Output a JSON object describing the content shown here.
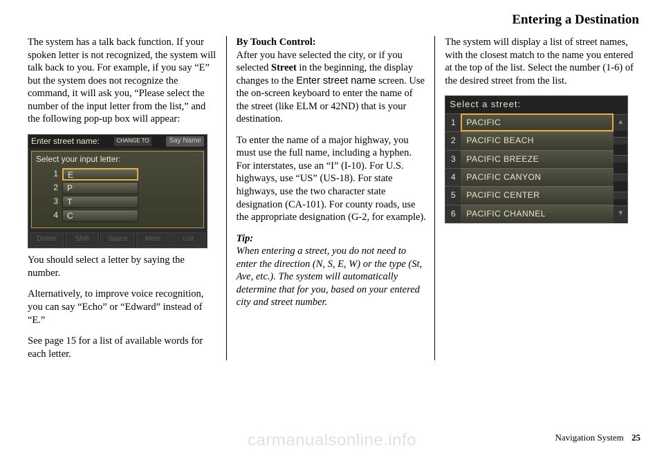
{
  "header": "Entering a Destination",
  "col1": {
    "p1": "The system has a talk back function. If your spoken letter is not recognized, the system will talk back to you. For example, if you say “E” but the system does not recognize the command, it will ask you, “Please select the number of the input letter from the list,” and the following pop-up box will appear:",
    "nav_title": "Enter street name:",
    "change": "CHANGE TO",
    "sayname": "Say Name",
    "popup_title": "Select your input letter:",
    "letters": [
      {
        "n": "1",
        "v": "E"
      },
      {
        "n": "2",
        "v": "P"
      },
      {
        "n": "3",
        "v": "T"
      },
      {
        "n": "4",
        "v": "C"
      }
    ],
    "footer_btns": [
      "Delete",
      "Shift",
      "Space",
      "More",
      "List"
    ],
    "p2": "You should select a letter by saying the number.",
    "p3": "Alternatively, to improve voice recognition, you can say “Echo” or “Edward” instead of “E.”",
    "p4": "See page 15 for a list of available words for each letter."
  },
  "col2": {
    "h": "By Touch Control:",
    "p1a": "After you have selected the city, or if you selected ",
    "p1b": "Street",
    "p1c": " in the beginning, the display changes to the ",
    "p1d": "Enter street name",
    "p1e": " screen. Use the on-screen keyboard to enter the name of the street (like ELM or 42ND) that is your destination.",
    "p2": "To enter the name of a major highway, you must use the full name, including a hyphen. For interstates, use an “I” (I-10). For U.S. highways, use “US” (US-18). For state highways, use the two character state designation (CA-101). For county roads, use the appropriate designation (G-2, for example).",
    "tip_h": "Tip:",
    "tip": "When entering a street, you do not need to enter the direction (N, S, E, W) or the type (St, Ave, etc.). The system will automatically determine that for you, based on your entered city and street number."
  },
  "col3": {
    "p1": "The system will display a list of street names, with the closest match to the name you entered at the top of the list. Select the number (1-6) of the desired street from the list.",
    "screen_title": "Select a street:",
    "streets": [
      "PACIFIC",
      "PACIFIC BEACH",
      "PACIFIC BREEZE",
      "PACIFIC CANYON",
      "PACIFIC CENTER",
      "PACIFIC CHANNEL"
    ]
  },
  "footer": {
    "label": "Navigation System",
    "page": "25"
  },
  "watermark": "carmanualsonline.info"
}
